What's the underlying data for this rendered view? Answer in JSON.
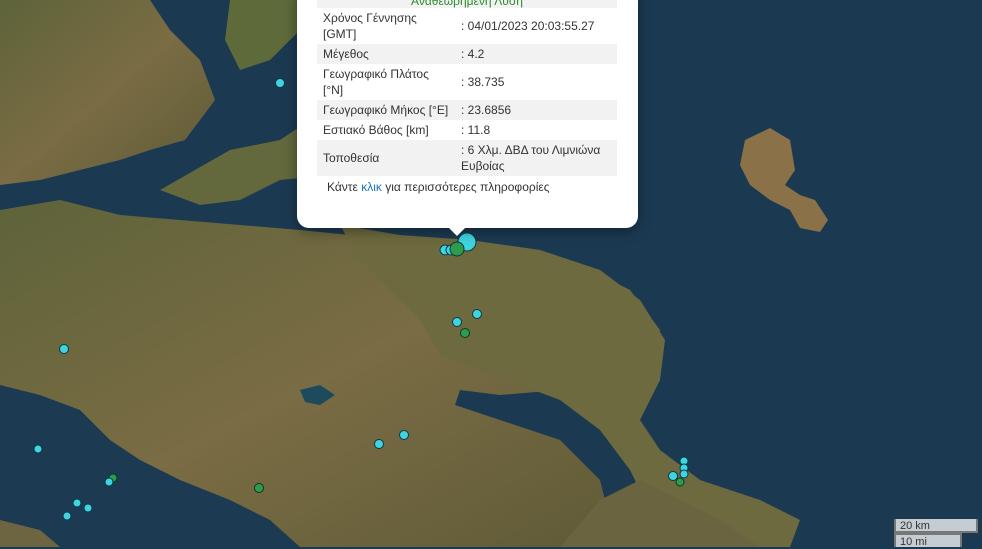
{
  "popup": {
    "status": "Αναθεωρημένη Λύση",
    "rows": [
      {
        "key": "Χρόνος Γέννησης [GMT]",
        "value": ": 04/01/2023 20:03:55.27"
      },
      {
        "key": "Μέγεθος",
        "value": ": 4.2"
      },
      {
        "key": "Γεωγραφικό Πλάτος [°N]",
        "value": ": 38.735"
      },
      {
        "key": "Γεωγραφικό Μήκος [°E]",
        "value": ": 23.6856"
      },
      {
        "key": "Εστιακό Βάθος [km]",
        "value": ": 11.8"
      },
      {
        "key": "Τοποθεσία",
        "value": ": 6 Χλμ. ΔΒΔ του Λιμνιώνα Ευβοίας"
      }
    ],
    "more_prefix": "Κάντε ",
    "more_link": "κλικ",
    "more_suffix": " για περισσότερες πληροφορίες"
  },
  "scale": {
    "km": "20 km",
    "mi": "10 mi"
  },
  "colors": {
    "sea": "#1b3a52",
    "land": "#6b6a3e",
    "marker_cyan": "#3fd4e0",
    "marker_green": "#2e9b4e",
    "link": "#1a73c7",
    "status": "#2e8b2e"
  }
}
